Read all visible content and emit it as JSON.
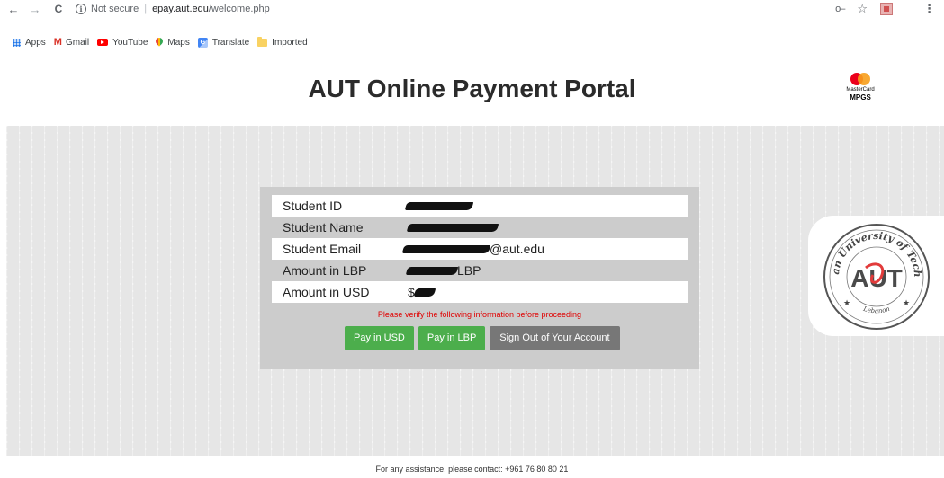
{
  "browser": {
    "security_label": "Not secure",
    "url_host": "epay.aut.edu",
    "url_path": "/welcome.php",
    "bookmarks": [
      {
        "label": "Apps",
        "icon": "apps-icon"
      },
      {
        "label": "Gmail",
        "icon": "gmail-icon"
      },
      {
        "label": "YouTube",
        "icon": "youtube-icon"
      },
      {
        "label": "Maps",
        "icon": "maps-icon"
      },
      {
        "label": "Translate",
        "icon": "translate-icon"
      },
      {
        "label": "Imported",
        "icon": "folder-icon"
      }
    ]
  },
  "header": {
    "title": "AUT Online Payment Portal",
    "mastercard_line1": "MasterCard",
    "mastercard_line2": "MPGS"
  },
  "student_info": {
    "rows": [
      {
        "label": "Student ID",
        "value_suffix": ""
      },
      {
        "label": "Student Name",
        "value_suffix": ""
      },
      {
        "label": "Student Email",
        "value_suffix": "@aut.edu"
      },
      {
        "label": "Amount in LBP",
        "value_suffix": "LBP"
      },
      {
        "label": "Amount in USD",
        "value_prefix": "$",
        "value_suffix": ""
      }
    ]
  },
  "warning": "Please verify the following information before proceeding",
  "buttons": {
    "pay_usd": "Pay in USD",
    "pay_lbp": "Pay in LBP",
    "sign_out": "Sign Out of Your Account"
  },
  "seal": {
    "top_text": "American University of Technology",
    "monogram": "AUT",
    "bottom_text": "Lebanon"
  },
  "footer": "For any assistance, please contact: +961 76 80 80 21",
  "colors": {
    "green_button": "#4cae4c",
    "gray_button": "#777777",
    "warning_red": "#e00000",
    "seal_red": "#e23b3b"
  }
}
